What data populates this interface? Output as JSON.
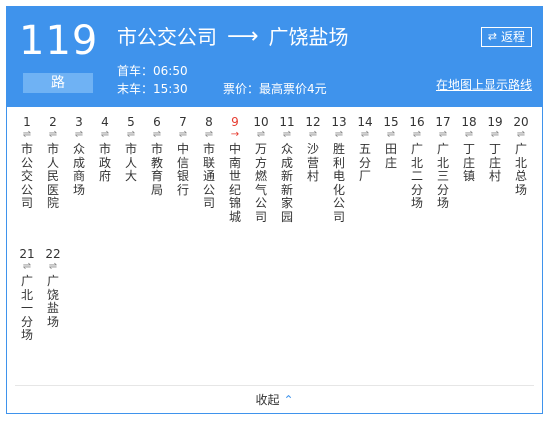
{
  "route": {
    "number": "119",
    "suffix": "路",
    "from": "市公交公司",
    "to": "广饶盐场",
    "first_bus": "首车：06:50",
    "last_bus": "末车：15:30",
    "fare": "票价：最高票价4元",
    "map_link": "在地图上显示路线",
    "return_label": "返程"
  },
  "icons": {
    "direction_arrow": "⟶",
    "swap": "⇄",
    "stop_dir": "⇌",
    "current_dir": "→",
    "collapse_chevron": "⌃"
  },
  "colors": {
    "primary": "#3f93ec",
    "current": "#e63a2e"
  },
  "stops": [
    {
      "num": "1",
      "name": "市公交公司"
    },
    {
      "num": "2",
      "name": "市人民医院"
    },
    {
      "num": "3",
      "name": "众成商场"
    },
    {
      "num": "4",
      "name": "市政府"
    },
    {
      "num": "5",
      "name": "市人大"
    },
    {
      "num": "6",
      "name": "市教育局"
    },
    {
      "num": "7",
      "name": "中信银行"
    },
    {
      "num": "8",
      "name": "市联通公司"
    },
    {
      "num": "9",
      "name": "中南世纪锦城",
      "current": true
    },
    {
      "num": "10",
      "name": "万方燃气公司"
    },
    {
      "num": "11",
      "name": "众成新新家园"
    },
    {
      "num": "12",
      "name": "沙营村"
    },
    {
      "num": "13",
      "name": "胜利电化公司"
    },
    {
      "num": "14",
      "name": "五分厂"
    },
    {
      "num": "15",
      "name": "田庄"
    },
    {
      "num": "16",
      "name": "广北二分场"
    },
    {
      "num": "17",
      "name": "广北三分场"
    },
    {
      "num": "18",
      "name": "丁庄镇"
    },
    {
      "num": "19",
      "name": "丁庄村"
    },
    {
      "num": "20",
      "name": "广北总场"
    },
    {
      "num": "21",
      "name": "广北一分场"
    },
    {
      "num": "22",
      "name": "广饶盐场"
    }
  ],
  "footer": {
    "collapse_label": "收起"
  }
}
